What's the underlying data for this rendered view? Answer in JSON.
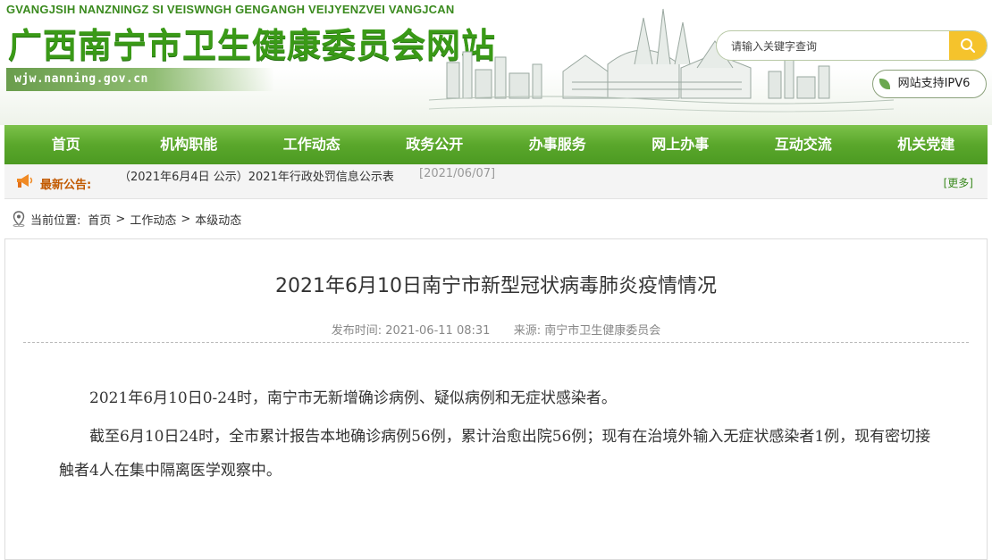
{
  "header": {
    "pinyin": "GVANGJSIH NANZNINGZ SI VEISWNGH GENGANGH VEIJYENZVEI VANGJCAN",
    "site_title": "广西南宁市卫生健康委员会网站",
    "url": "wjw.nanning.gov.cn",
    "search_placeholder": "请输入关键字查询",
    "ipv6_label": "网站支持IPV6"
  },
  "nav": {
    "items": [
      "首页",
      "机构职能",
      "工作动态",
      "政务公开",
      "办事服务",
      "网上办事",
      "互动交流",
      "机关党建"
    ]
  },
  "notice": {
    "label": "最新公告:",
    "item": "（2021年6月4日 公示）2021年行政处罚信息公示表",
    "date": "[2021/06/07]",
    "more": "[更多]"
  },
  "breadcrumb": {
    "prefix": "当前位置:",
    "items": [
      "首页",
      "工作动态",
      "本级动态"
    ],
    "separator": ">"
  },
  "article": {
    "title": "2021年6月10日南宁市新型冠状病毒肺炎疫情情况",
    "publish_label": "发布时间:",
    "publish_time": "2021-06-11 08:31",
    "source_label": "来源:",
    "source": "南宁市卫生健康委员会",
    "paragraphs": [
      "2021年6月10日0-24时，南宁市无新增确诊病例、疑似病例和无症状感染者。",
      "截至6月10日24时，全市累计报告本地确诊病例56例，累计治愈出院56例；现有在治境外输入无症状感染者1例，现有密切接触者4人在集中隔离医学观察中。"
    ]
  },
  "colors": {
    "nav_green": "#5aa72b",
    "title_green": "#3a9a17",
    "search_button": "#f5c32c",
    "notice_label": "#c25a00"
  },
  "icons": {
    "search": "search-icon",
    "horn": "megaphone-icon",
    "location": "location-pin-icon",
    "leaf": "leaf-icon"
  }
}
